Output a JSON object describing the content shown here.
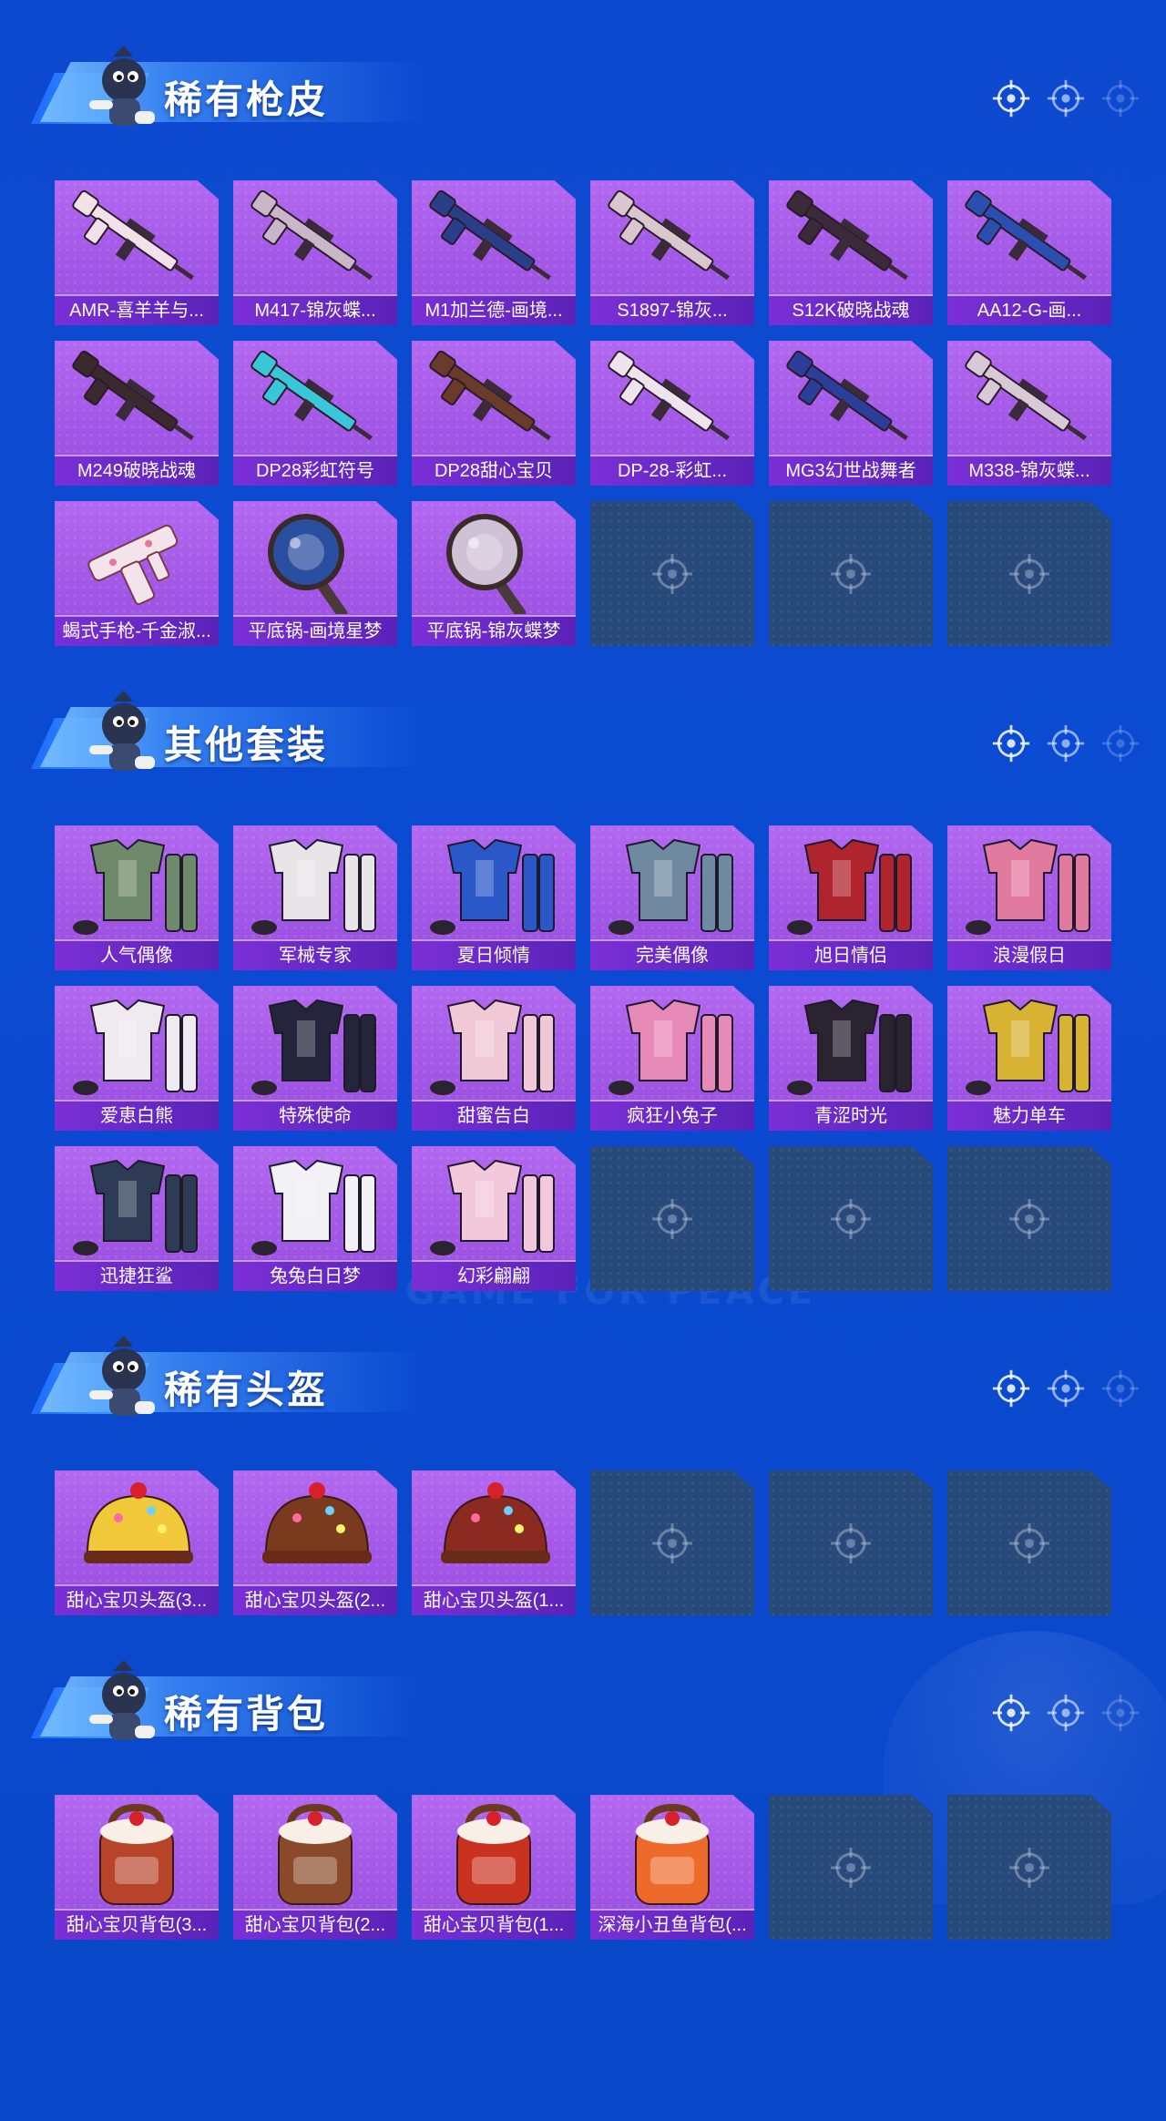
{
  "sections": [
    {
      "title": "稀有枪皮",
      "items": [
        {
          "label": "AMR-喜羊羊与...",
          "kind": "gun",
          "color": "#f3e1ea"
        },
        {
          "label": "M417-锦灰蝶...",
          "kind": "gun",
          "color": "#c9b6c9"
        },
        {
          "label": "M1加兰德-画境...",
          "kind": "gun",
          "color": "#2a3f8a"
        },
        {
          "label": "S1897-锦灰...",
          "kind": "gun",
          "color": "#d9c6cf"
        },
        {
          "label": "S12K破晓战魂",
          "kind": "gun",
          "color": "#3b2a3a"
        },
        {
          "label": "AA12-G-画...",
          "kind": "gun",
          "color": "#2a4fb0"
        },
        {
          "label": "M249破晓战魂",
          "kind": "gun",
          "color": "#3a2a30"
        },
        {
          "label": "DP28彩虹符号",
          "kind": "gun",
          "color": "#38c6d8"
        },
        {
          "label": "DP28甜心宝贝",
          "kind": "gun",
          "color": "#6a3a2a"
        },
        {
          "label": "DP-28-彩虹...",
          "kind": "gun",
          "color": "#eee4ee"
        },
        {
          "label": "MG3幻世战舞者",
          "kind": "gun",
          "color": "#2b3e9a"
        },
        {
          "label": "M338-锦灰蝶...",
          "kind": "gun",
          "color": "#d8c9d6"
        },
        {
          "label": "蝎式手枪-千金淑...",
          "kind": "pistol",
          "color": "#f2e4ea"
        },
        {
          "label": "平底锅-画境星梦",
          "kind": "pan",
          "color": "#2b4fa0"
        },
        {
          "label": "平底锅-锦灰蝶梦",
          "kind": "pan",
          "color": "#cfc2d6"
        }
      ],
      "empty_slots": 3
    },
    {
      "title": "其他套装",
      "items": [
        {
          "label": "人气偶像",
          "kind": "outfit",
          "color": "#6f8a6a"
        },
        {
          "label": "军械专家",
          "kind": "outfit",
          "color": "#e8e4e8"
        },
        {
          "label": "夏日倾情",
          "kind": "outfit",
          "color": "#2a58c8"
        },
        {
          "label": "完美偶像",
          "kind": "outfit",
          "color": "#6f8aa0"
        },
        {
          "label": "旭日情侣",
          "kind": "outfit",
          "color": "#b0242e"
        },
        {
          "label": "浪漫假日",
          "kind": "outfit",
          "color": "#e27aa0"
        },
        {
          "label": "爱恵白熊",
          "kind": "outfit",
          "color": "#eeeaf0"
        },
        {
          "label": "特殊使命",
          "kind": "outfit",
          "color": "#23263a"
        },
        {
          "label": "甜蜜告白",
          "kind": "outfit",
          "color": "#f0c8d6"
        },
        {
          "label": "疯狂小兔子",
          "kind": "outfit",
          "color": "#e88ab8"
        },
        {
          "label": "青涩时光",
          "kind": "outfit",
          "color": "#2a2430"
        },
        {
          "label": "魅力单车",
          "kind": "outfit",
          "color": "#d8b233"
        },
        {
          "label": "迅捷狂鲨",
          "kind": "outfit",
          "color": "#2e3b55"
        },
        {
          "label": "兔兔白日梦",
          "kind": "outfit",
          "color": "#f2f2f6"
        },
        {
          "label": "幻彩翩翩",
          "kind": "outfit",
          "color": "#f3c8da"
        }
      ],
      "empty_slots": 3
    },
    {
      "title": "稀有头盔",
      "items": [
        {
          "label": "甜心宝贝头盔(3...",
          "kind": "helmet",
          "color": "#f0c83a"
        },
        {
          "label": "甜心宝贝头盔(2...",
          "kind": "helmet",
          "color": "#7a3a1e"
        },
        {
          "label": "甜心宝贝头盔(1...",
          "kind": "helmet",
          "color": "#8a2a20"
        }
      ],
      "empty_slots": 3
    },
    {
      "title": "稀有背包",
      "items": [
        {
          "label": "甜心宝贝背包(3...",
          "kind": "backpack",
          "color": "#b8442a"
        },
        {
          "label": "甜心宝贝背包(2...",
          "kind": "backpack",
          "color": "#8a4a2a"
        },
        {
          "label": "甜心宝贝背包(1...",
          "kind": "backpack",
          "color": "#c8321e"
        },
        {
          "label": "深海小丑鱼背包(...",
          "kind": "backpack",
          "color": "#ee6a2a"
        }
      ],
      "empty_slots": 2
    }
  ],
  "watermark": "GAME FOR PEACE"
}
